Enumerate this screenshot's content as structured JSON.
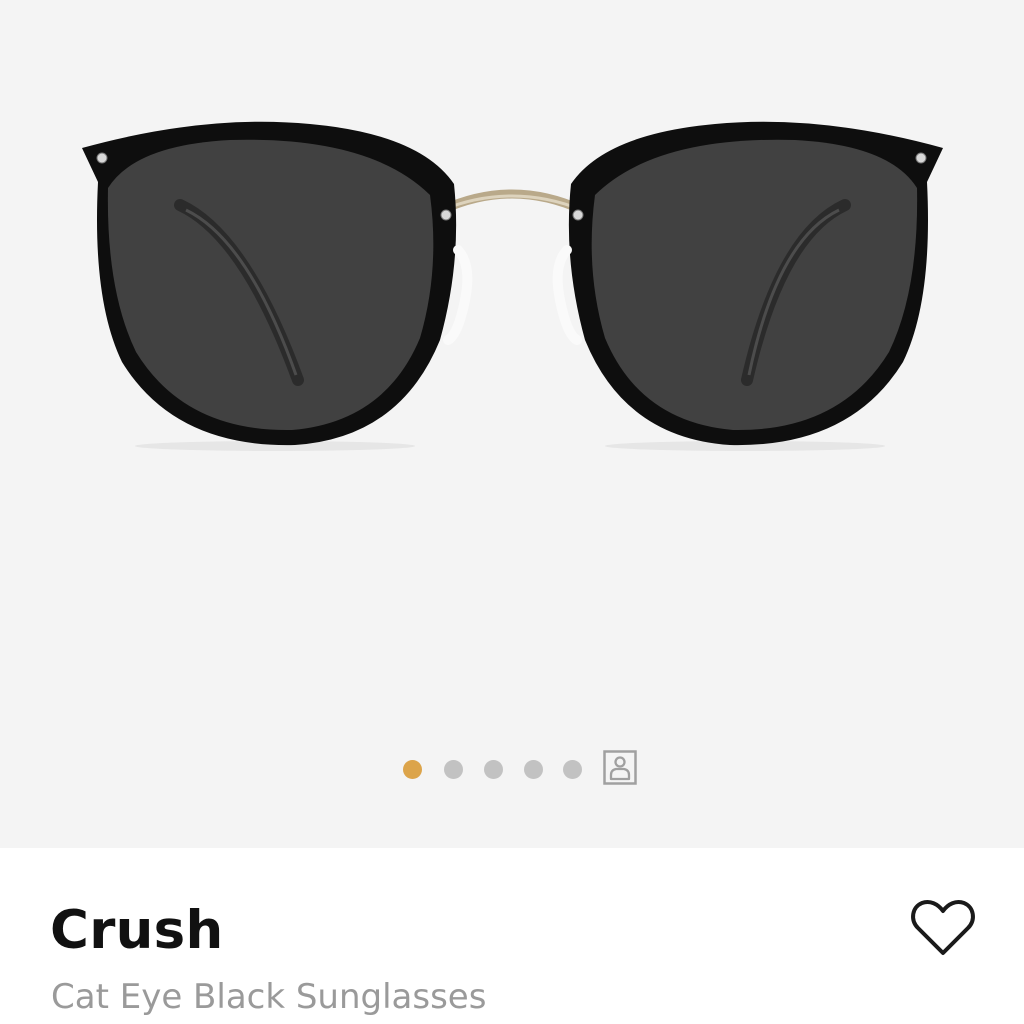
{
  "product": {
    "name": "Crush",
    "subtitle": "Cat Eye Black Sunglasses",
    "image_icon": "sunglasses-product-image"
  },
  "gallery": {
    "slides": [
      {
        "name": "carousel-dot-1",
        "active": true
      },
      {
        "name": "carousel-dot-2",
        "active": false
      },
      {
        "name": "carousel-dot-3",
        "active": false
      },
      {
        "name": "carousel-dot-4",
        "active": false
      },
      {
        "name": "carousel-dot-5",
        "active": false
      }
    ],
    "virtual_try_on_icon": "person-frame-icon"
  },
  "actions": {
    "favorite_icon": "heart-icon"
  },
  "colors": {
    "gallery_background": "#f4f4f4",
    "active_dot": "#dca44a",
    "inactive_dot": "#c2c2c2",
    "title_text": "#111111",
    "subtitle_text": "#9a9a9a"
  }
}
